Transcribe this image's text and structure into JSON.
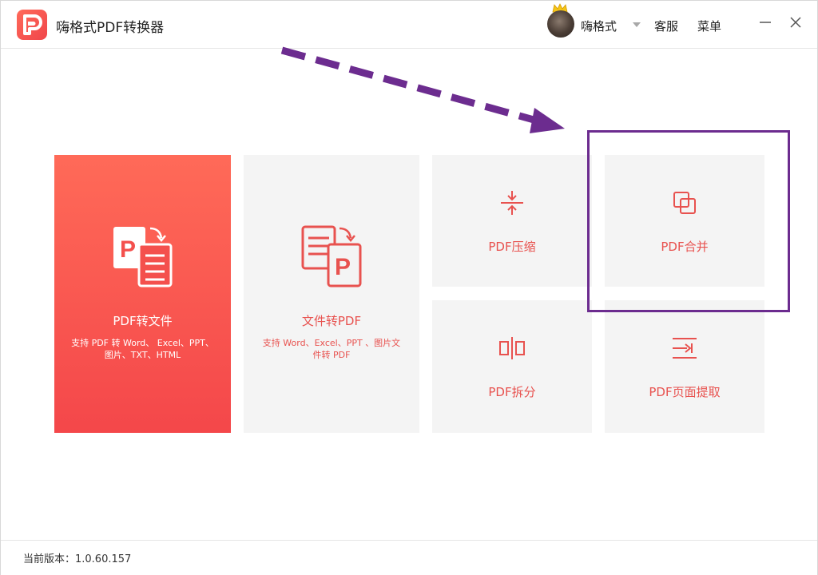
{
  "app": {
    "title": "嗨格式PDF转换器",
    "accent_color": "#f4504d",
    "logo_icon": "pdf-logo-icon"
  },
  "header": {
    "user_name": "嗨格式",
    "service_label": "客服",
    "menu_label": "菜单",
    "minimize_icon": "minimize-icon",
    "close_icon": "close-icon"
  },
  "cards": {
    "pdf_to_file": {
      "title": "PDF转文件",
      "desc": "支持 PDF 转 Word、 Excel、PPT、图片、TXT、HTML",
      "icon": "pdf-to-doc-icon"
    },
    "file_to_pdf": {
      "title": "文件转PDF",
      "desc": "支持 Word、Excel、PPT 、图片文件转 PDF",
      "icon": "doc-to-pdf-icon"
    },
    "compress": {
      "title": "PDF压缩",
      "icon": "compress-icon"
    },
    "merge": {
      "title": "PDF合并",
      "icon": "merge-icon"
    },
    "split": {
      "title": "PDF拆分",
      "icon": "split-icon"
    },
    "extract": {
      "title": "PDF页面提取",
      "icon": "extract-icon"
    }
  },
  "annotation": {
    "arrow_color": "#6c2c8f",
    "highlight_target": "merge"
  },
  "footer": {
    "version_text": "当前版本：1.0.60.157"
  }
}
